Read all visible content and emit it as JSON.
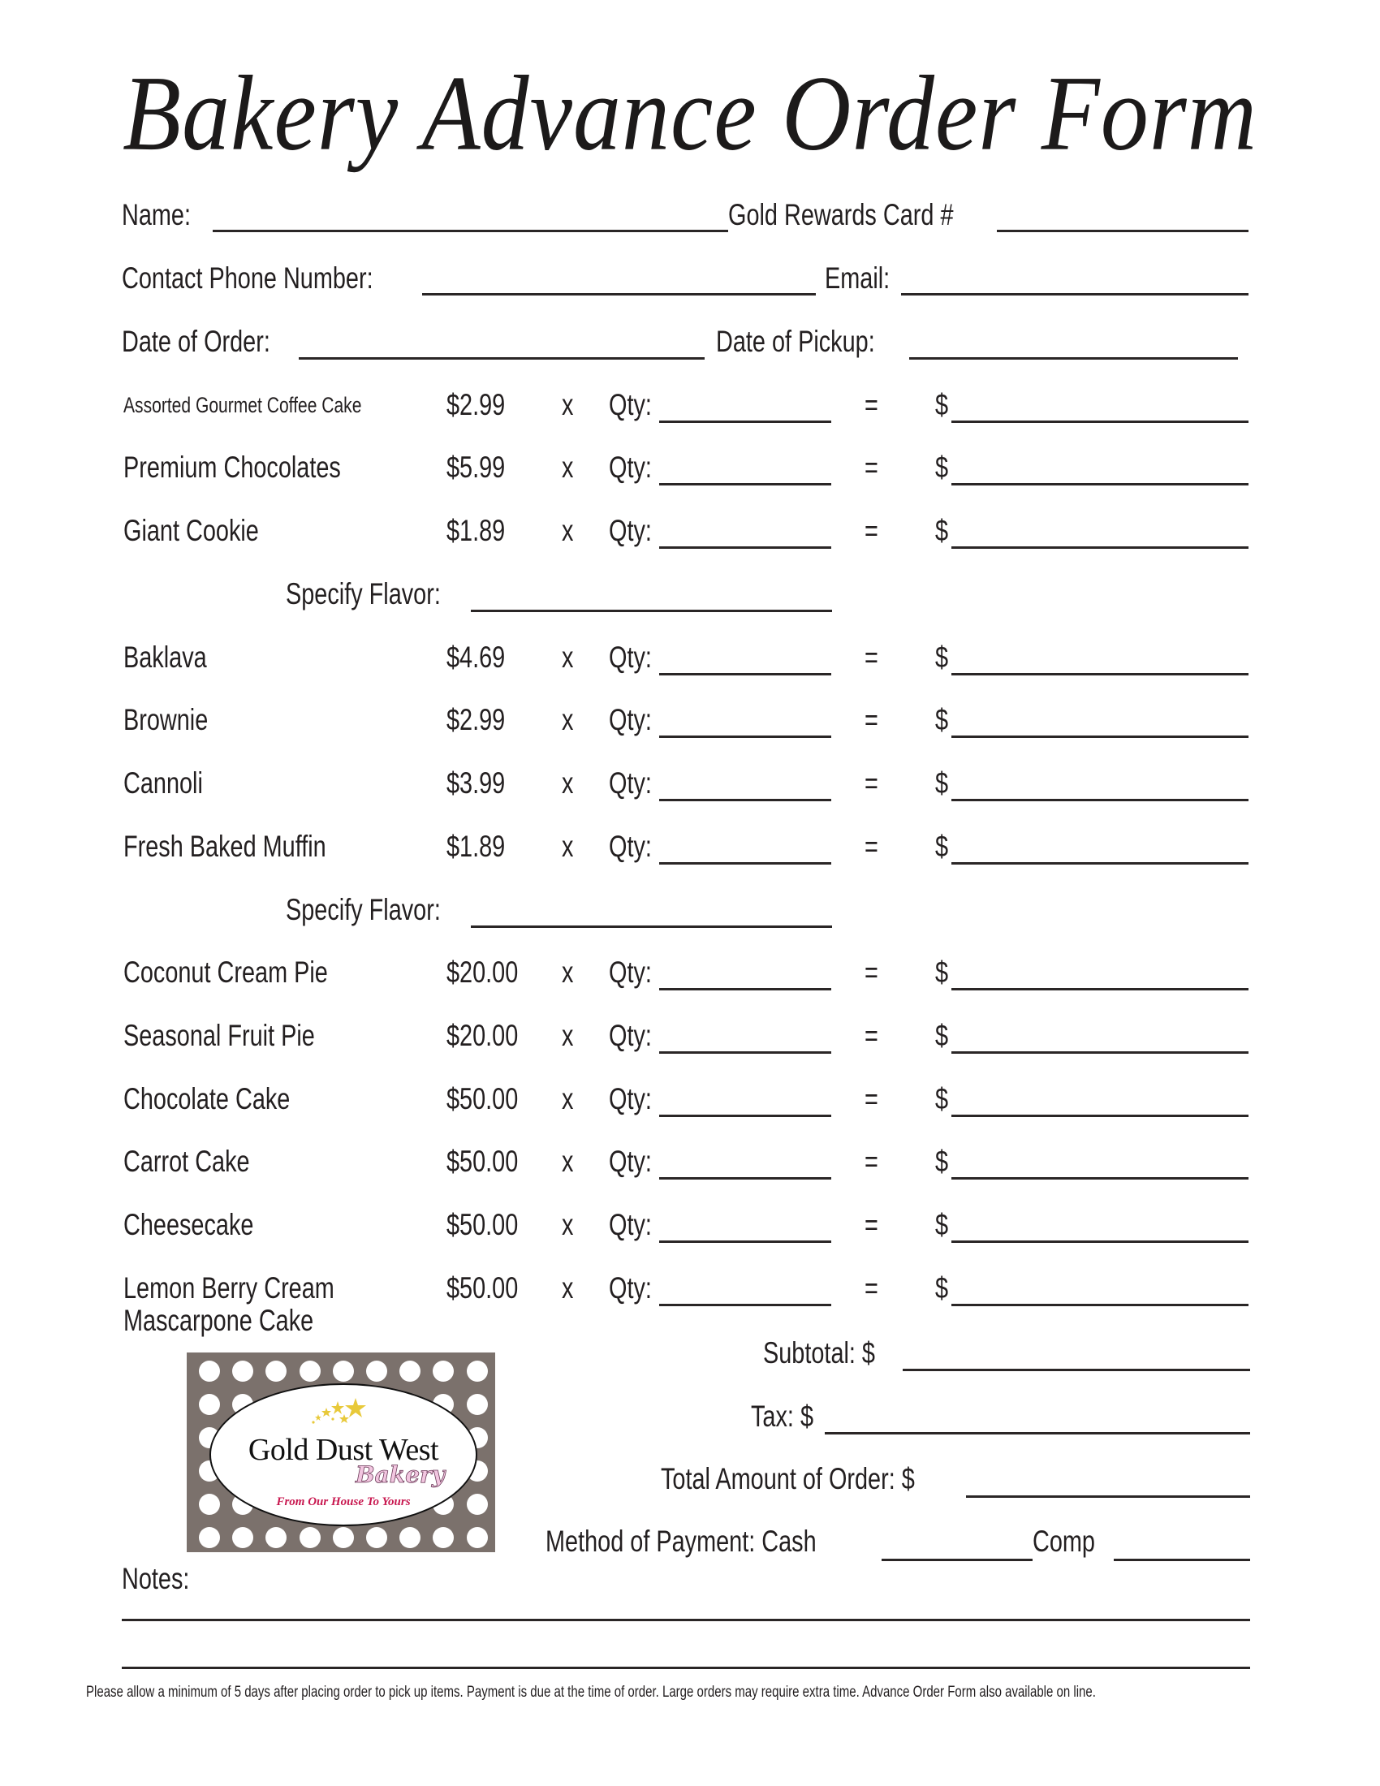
{
  "title": "Bakery Advance Order Form",
  "customer_fields": {
    "name_label": "Name:",
    "rewards_label": "Gold Rewards Card #",
    "phone_label": "Contact Phone Number:",
    "email_label": "Email:",
    "order_date_label": "Date of Order:",
    "pickup_date_label": "Date of Pickup:"
  },
  "line_labels": {
    "times": "x",
    "qty": "Qty:",
    "equals": "=",
    "dollar": "$",
    "flavor": "Specify Flavor:"
  },
  "items": [
    {
      "name": "Assorted Gourmet Coffee Cake",
      "price": "$2.99"
    },
    {
      "name": "Premium Chocolates",
      "price": "$5.99"
    },
    {
      "name": "Giant Cookie",
      "price": "$1.89",
      "flavor": true
    },
    {
      "name": "Baklava",
      "price": "$4.69"
    },
    {
      "name": "Brownie",
      "price": "$2.99"
    },
    {
      "name": "Cannoli",
      "price": "$3.99"
    },
    {
      "name": "Fresh Baked Muffin",
      "price": "$1.89",
      "flavor": true
    },
    {
      "name": "Coconut Cream Pie",
      "price": "$20.00"
    },
    {
      "name": "Seasonal Fruit Pie",
      "price": "$20.00"
    },
    {
      "name": "Chocolate Cake",
      "price": "$50.00"
    },
    {
      "name": "Carrot Cake",
      "price": "$50.00"
    },
    {
      "name": "Cheesecake",
      "price": "$50.00"
    },
    {
      "name": "Lemon Berry Cream",
      "name_line2": "Mascarpone Cake",
      "price": "$50.00"
    }
  ],
  "totals": {
    "subtotal_label": "Subtotal:  $",
    "tax_label": "Tax: $",
    "total_label": "Total Amount of Order: $",
    "payment_label": "Method of Payment:  Cash",
    "comp_label": "Comp"
  },
  "logo": {
    "name": "Gold Dust West",
    "sub": "Bakery",
    "tagline": "From Our House To Yours",
    "colors": {
      "background": "#7b716c",
      "bakery": "#f2c6e0",
      "tagline": "#c8174f",
      "stars": "#e8c93a"
    }
  },
  "notes_label": "Notes:",
  "footer": "Please allow a minimum of 5 days after placing order to pick up items.  Payment is due at the time of order.  Large orders may require extra time.  Advance Order Form also available on line."
}
